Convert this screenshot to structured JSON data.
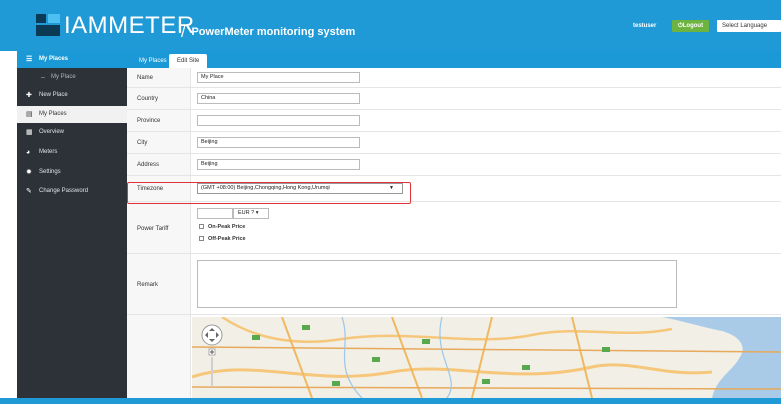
{
  "header": {
    "brand": "IAMMETER",
    "subtitle_sep": "/",
    "subtitle": "PowerMeter monitoring system",
    "user": "testuser",
    "logout_label": "Logout",
    "language_label": "Select Language"
  },
  "sidebar": {
    "items": [
      {
        "label": "My Places",
        "icon": "grid-icon",
        "glyph": "☰",
        "state": "head"
      },
      {
        "label": "My Place",
        "icon": "chevron-icon",
        "glyph": "–",
        "state": "sub"
      },
      {
        "label": "New Place",
        "icon": "plus-icon",
        "glyph": "✚",
        "state": ""
      },
      {
        "label": "My Places",
        "icon": "list-icon",
        "glyph": "▦",
        "state": "active"
      },
      {
        "label": "Overview",
        "icon": "table-icon",
        "glyph": "▦",
        "state": ""
      },
      {
        "label": "Meters",
        "icon": "dashboard-icon",
        "glyph": "◕",
        "state": ""
      },
      {
        "label": "Settings",
        "icon": "gear-icon",
        "glyph": "✹",
        "state": ""
      },
      {
        "label": "Change Password",
        "icon": "edit-icon",
        "glyph": "✎",
        "state": ""
      }
    ]
  },
  "tabs": [
    {
      "label": "My Places",
      "active": false
    },
    {
      "label": "Edit Site",
      "active": true
    }
  ],
  "form": {
    "name_label": "Name",
    "name_value": "My Place",
    "country_label": "Country",
    "country_value": "China",
    "province_label": "Province",
    "province_value": "",
    "city_label": "City",
    "city_value": "Beijing",
    "address_label": "Address",
    "address_value": "Beijing",
    "timezone_label": "Timezone",
    "timezone_value": "(GMT +08:00) Beijing,Chongqing,Hong Kong,Urumqi",
    "tariff_label": "Power Tariff",
    "currency_value": "EUR ?",
    "onpeak_label": "On-Peak Price",
    "offpeak_label": "Off-Peak Price",
    "remark_label": "Remark"
  },
  "colors": {
    "header": "#1f9ad6",
    "sidebar": "#2c3238",
    "logout": "#6cb33f",
    "highlight": "#e0323a"
  }
}
